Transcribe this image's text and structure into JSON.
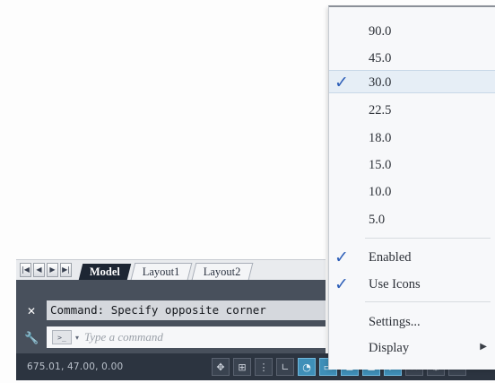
{
  "layout_tabs": {
    "nav_buttons": [
      "|◀",
      "◀",
      "▶",
      "▶|"
    ],
    "tabs": [
      "Model",
      "Layout1",
      "Layout2"
    ]
  },
  "command": {
    "history": "Command: Specify opposite corner",
    "placeholder": "Type a command",
    "prompt_icon": ">_"
  },
  "status": {
    "coords": "675.01, 47.00, 0.00"
  },
  "polar_menu": {
    "angles": [
      {
        "label": "90.0",
        "checked": false
      },
      {
        "label": "45.0",
        "checked": false
      },
      {
        "label": "30.0",
        "checked": true
      },
      {
        "label": "22.5",
        "checked": false
      },
      {
        "label": "18.0",
        "checked": false
      },
      {
        "label": "15.0",
        "checked": false
      },
      {
        "label": "10.0",
        "checked": false
      },
      {
        "label": "5.0",
        "checked": false
      }
    ],
    "enabled_label": "Enabled",
    "use_icons_label": "Use Icons",
    "settings_label": "Settings...",
    "display_label": "Display",
    "check_glyph": "✓",
    "accent": "#2e5fb8"
  }
}
